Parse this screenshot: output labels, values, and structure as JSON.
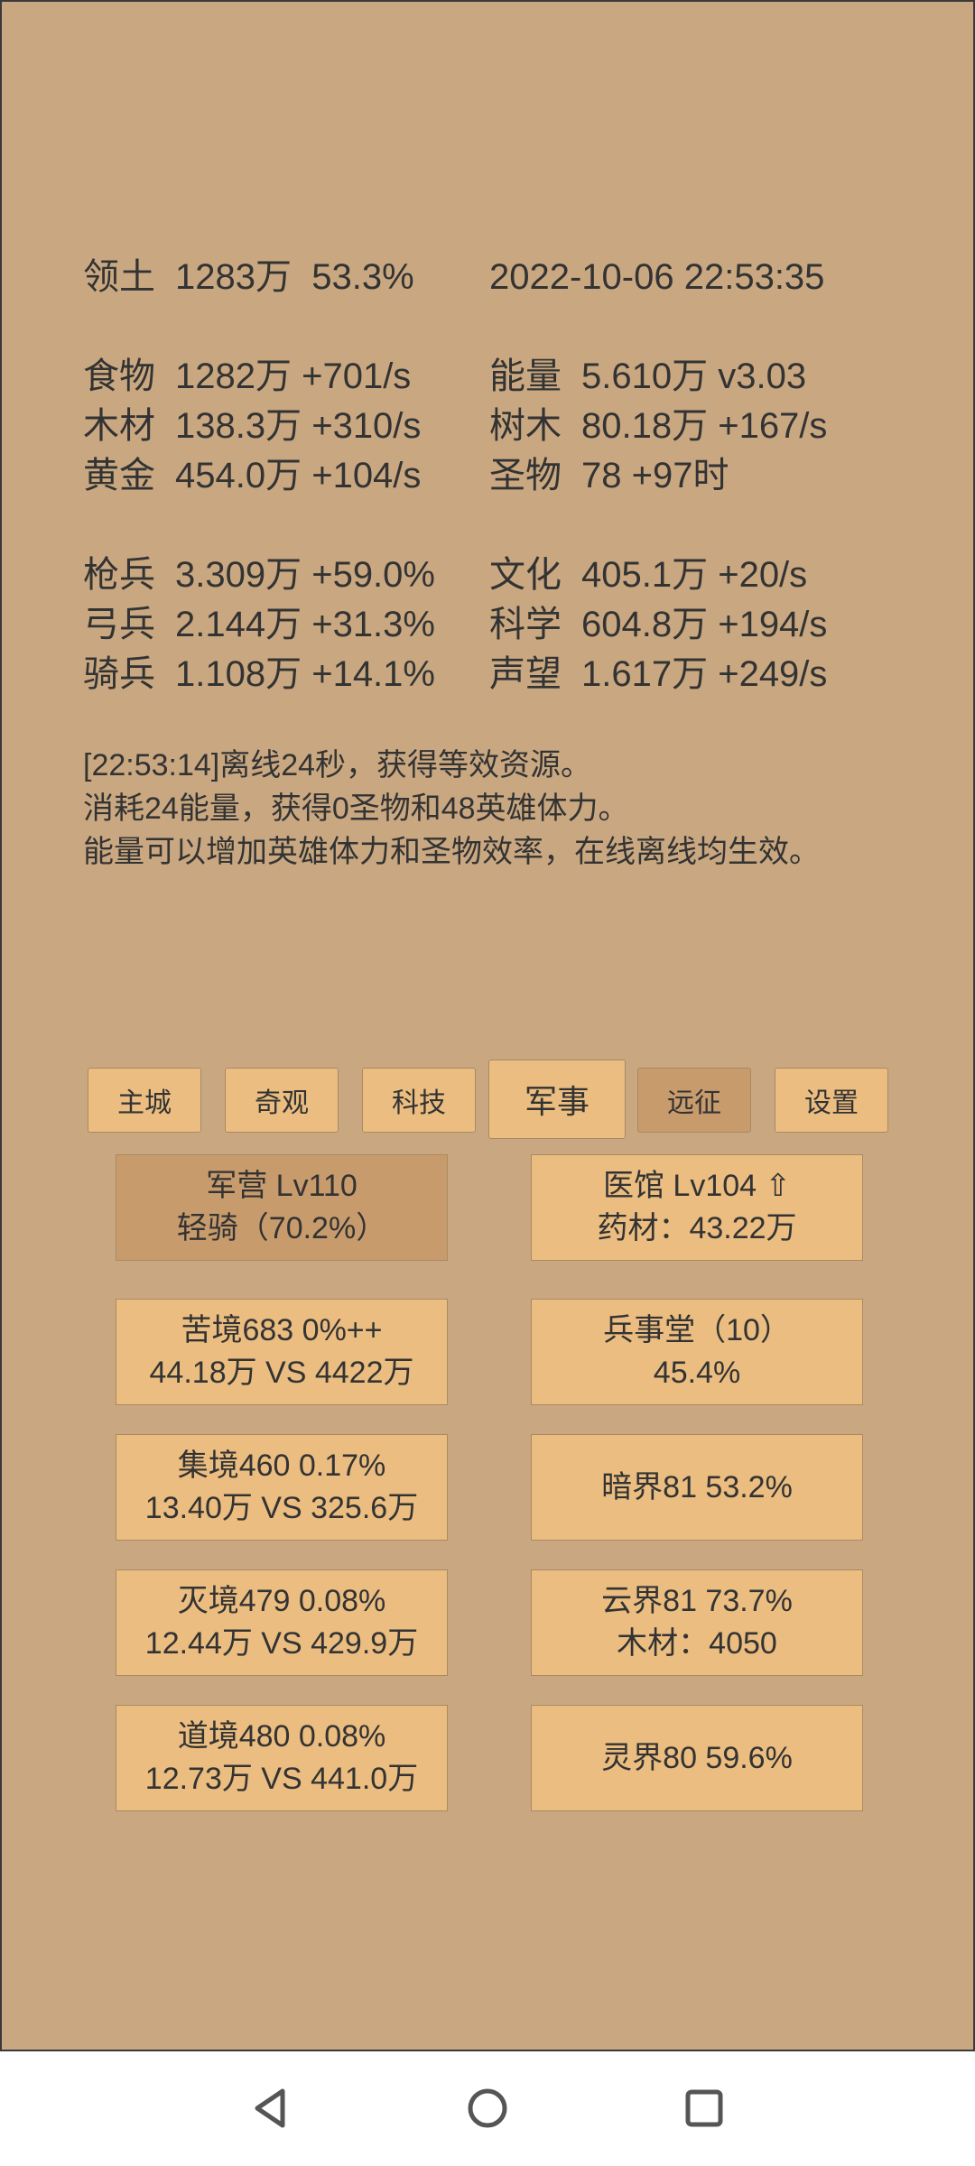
{
  "stats": {
    "territory": {
      "label": "领土",
      "value": "1283万",
      "extra": "53.3%"
    },
    "datetime": "2022-10-06 22:53:35",
    "left": [
      {
        "label": "食物",
        "value": "1282万 +701/s"
      },
      {
        "label": "木材",
        "value": "138.3万 +310/s"
      },
      {
        "label": "黄金",
        "value": "454.0万 +104/s"
      },
      {
        "label": "枪兵",
        "value": "3.309万 +59.0%"
      },
      {
        "label": "弓兵",
        "value": "2.144万 +31.3%"
      },
      {
        "label": "骑兵",
        "value": "1.108万 +14.1%"
      }
    ],
    "right": [
      {
        "label": "能量",
        "value": "5.610万  v3.03"
      },
      {
        "label": "树木",
        "value": "80.18万 +167/s"
      },
      {
        "label": "圣物",
        "value": "78 +97时"
      },
      {
        "label": "文化",
        "value": "405.1万 +20/s"
      },
      {
        "label": "科学",
        "value": "604.8万 +194/s"
      },
      {
        "label": "声望",
        "value": "1.617万 +249/s"
      }
    ]
  },
  "messages": [
    "[22:53:14]离线24秒，获得等效资源。",
    "消耗24能量，获得0圣物和48英雄体力。",
    "能量可以增加英雄体力和圣物效率，在线离线均生效。"
  ],
  "tabs": [
    "主城",
    "奇观",
    "科技",
    "军事",
    "远征",
    "设置"
  ],
  "cards": [
    {
      "line1": "军营 Lv110",
      "line2": "轻骑（70.2%）"
    },
    {
      "line1": "医馆 Lv104 ⇧",
      "line2": "药材：43.22万"
    },
    {
      "line1": "苦境683  0%++",
      "line2": "44.18万 VS 4422万"
    },
    {
      "line1": "兵事堂（10）",
      "line2": "45.4%"
    },
    {
      "line1": "集境460  0.17%",
      "line2": "13.40万 VS 325.6万"
    },
    {
      "line1": "暗界81  53.2%",
      "line2": ""
    },
    {
      "line1": "灭境479  0.08%",
      "line2": "12.44万 VS 429.9万"
    },
    {
      "line1": "云界81  73.7%",
      "line2": "木材：4050"
    },
    {
      "line1": "道境480  0.08%",
      "line2": "12.73万 VS 441.0万"
    },
    {
      "line1": "灵界80  59.6%",
      "line2": ""
    }
  ],
  "colors": {
    "background": "#c9a881",
    "button": "#ebbd80",
    "button_selected": "#c89b6c",
    "text": "#333333"
  }
}
